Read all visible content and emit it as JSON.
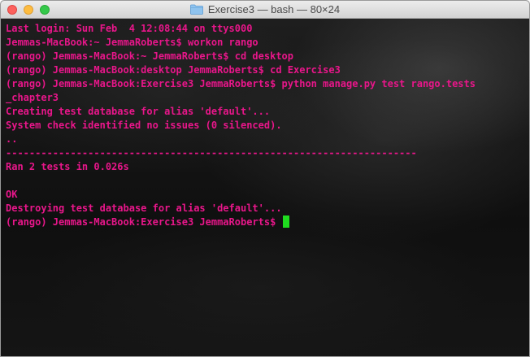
{
  "window": {
    "title": "Exercise3 — bash — 80×24",
    "colors": {
      "text": "#e8168a",
      "cursor": "#1fdc1f"
    }
  },
  "terminal": {
    "lines": [
      "Last login: Sun Feb  4 12:08:44 on ttys000",
      "Jemmas-MacBook:~ JemmaRoberts$ workon rango",
      "(rango) Jemmas-MacBook:~ JemmaRoberts$ cd desktop",
      "(rango) Jemmas-MacBook:desktop JemmaRoberts$ cd Exercise3",
      "(rango) Jemmas-MacBook:Exercise3 JemmaRoberts$ python manage.py test rango.tests",
      "_chapter3",
      "Creating test database for alias 'default'...",
      "System check identified no issues (0 silenced).",
      "..",
      "----------------------------------------------------------------------",
      "Ran 2 tests in 0.026s",
      "",
      "OK",
      "Destroying test database for alias 'default'...",
      "(rango) Jemmas-MacBook:Exercise3 JemmaRoberts$ "
    ]
  }
}
